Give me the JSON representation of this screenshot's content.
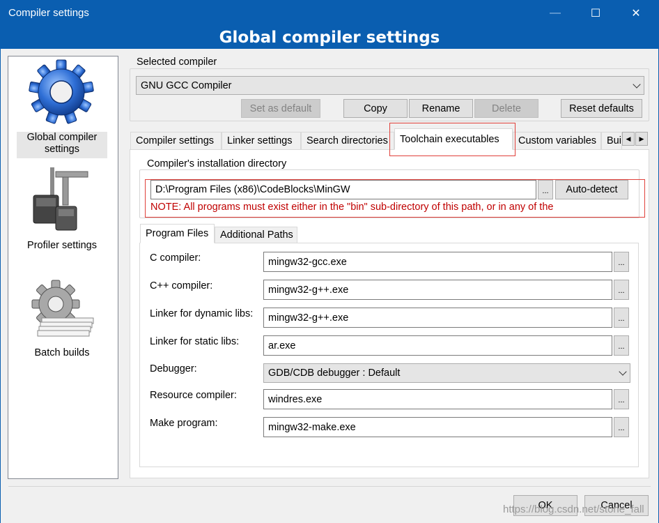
{
  "window": {
    "title": "Compiler settings",
    "controls": {
      "minimize": "—",
      "maximize": "☐",
      "close": "✕"
    },
    "banner": "Global compiler settings"
  },
  "categories": [
    {
      "label": "Global compiler settings",
      "icon": "gear-icon",
      "selected": true
    },
    {
      "label": "Profiler settings",
      "icon": "profiler-icon"
    },
    {
      "label": "Batch builds",
      "icon": "batch-builds-icon"
    }
  ],
  "selected_compiler": {
    "group_label": "Selected compiler",
    "value": "GNU GCC Compiler",
    "buttons": {
      "set_default": "Set as default",
      "copy": "Copy",
      "rename": "Rename",
      "delete": "Delete",
      "reset": "Reset defaults"
    }
  },
  "tabs": [
    {
      "label": "Compiler settings"
    },
    {
      "label": "Linker settings"
    },
    {
      "label": "Search directories"
    },
    {
      "label": "Toolchain executables",
      "active": true
    },
    {
      "label": "Custom variables"
    },
    {
      "label": "Bui"
    }
  ],
  "install_dir": {
    "group_label": "Compiler's installation directory",
    "value": "D:\\Program Files (x86)\\CodeBlocks\\MinGW",
    "browse": "...",
    "autodetect": "Auto-detect",
    "note": "NOTE: All programs must exist either in the \"bin\" sub-directory of this path, or in any of the"
  },
  "subtabs": [
    {
      "label": "Program Files",
      "active": true
    },
    {
      "label": "Additional Paths"
    }
  ],
  "program_files": [
    {
      "label": "C compiler:",
      "value": "mingw32-gcc.exe"
    },
    {
      "label": "C++ compiler:",
      "value": "mingw32-g++.exe"
    },
    {
      "label": "Linker for dynamic libs:",
      "value": "mingw32-g++.exe"
    },
    {
      "label": "Linker for static libs:",
      "value": "ar.exe"
    },
    {
      "label": "Debugger:",
      "value": "GDB/CDB debugger : Default"
    },
    {
      "label": "Resource compiler:",
      "value": "windres.exe"
    },
    {
      "label": "Make program:",
      "value": "mingw32-make.exe"
    }
  ],
  "browse_label": "...",
  "footer": {
    "ok": "OK",
    "cancel": "Cancel"
  },
  "watermark": "https://blog.csdn.net/stone_fall",
  "colors": {
    "title_bar": "#0a5eb0",
    "note_text": "#c00000",
    "highlight_box": "#e0403a"
  }
}
